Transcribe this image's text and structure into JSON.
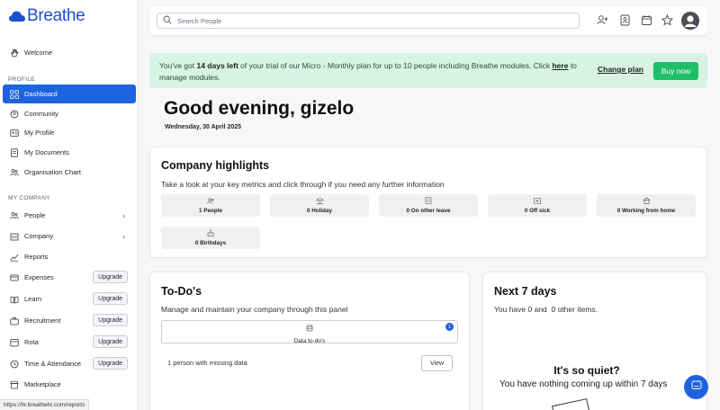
{
  "brand": {
    "name": "Breathe",
    "color": "#1f4fd1"
  },
  "sidebar": {
    "welcome": "Welcome",
    "profile_label": "PROFILE",
    "profile_items": [
      {
        "label": "Dashboard",
        "icon": "dashboard-icon",
        "active": true
      },
      {
        "label": "Community",
        "icon": "community-icon"
      },
      {
        "label": "My Profile",
        "icon": "profile-icon"
      },
      {
        "label": "My Documents",
        "icon": "documents-icon"
      },
      {
        "label": "Organisation Chart",
        "icon": "org-chart-icon"
      }
    ],
    "company_label": "MY COMPANY",
    "company_items": [
      {
        "label": "People",
        "icon": "people-icon"
      },
      {
        "label": "Company",
        "icon": "company-icon"
      },
      {
        "label": "Reports",
        "icon": "reports-icon"
      },
      {
        "label": "Expenses",
        "icon": "expenses-icon",
        "badge": "Upgrade"
      },
      {
        "label": "Learn",
        "icon": "learn-icon",
        "badge": "Upgrade"
      },
      {
        "label": "Recruitment",
        "icon": "recruitment-icon",
        "badge": "Upgrade"
      },
      {
        "label": "Rota",
        "icon": "rota-icon",
        "badge": "Upgrade"
      },
      {
        "label": "Time & Attendance",
        "icon": "time-icon",
        "badge": "Upgrade"
      },
      {
        "label": "Marketplace",
        "icon": "marketplace-icon"
      }
    ]
  },
  "search": {
    "placeholder": "Search People"
  },
  "banner": {
    "text_1": "You've got ",
    "days": "14 days left",
    "text_2": " of your trial of our Micro - Monthly plan for up to 10 people including Breathe modules. Click ",
    "link": "here",
    "text_3": " to manage modules.",
    "change_plan": "Change plan",
    "buy_now": "Buy now",
    "background": "#d8f3e3",
    "button_color": "#1fbf69"
  },
  "greeting": "Good evening, gizelo",
  "date": "Wednesday, 30 April 2025",
  "highlights": {
    "title": "Company highlights",
    "subtitle": "Take a look at your key metrics and click through if you need any further information",
    "metrics": [
      {
        "label": "1 People",
        "icon": "people-icon"
      },
      {
        "label": "0 Holiday",
        "icon": "holiday-icon"
      },
      {
        "label": "0 On other leave",
        "icon": "leave-icon"
      },
      {
        "label": "0 Off sick",
        "icon": "sick-icon"
      },
      {
        "label": "0 Working from home",
        "icon": "home-icon"
      },
      {
        "label": "0 Birthdays",
        "icon": "birthday-icon"
      }
    ]
  },
  "todo": {
    "title": "To-Do's",
    "subtitle": "Manage and maintain your company through this panel",
    "box_label": "Data to-do's",
    "badge": "1",
    "row_text": "1 person with missing data",
    "view": "View"
  },
  "next7": {
    "title": "Next 7 days",
    "subtitle": "You have 0 and  0 other items.",
    "quiet_title": "It's so quiet?",
    "quiet_sub": "You have nothing coming up within 7 days"
  },
  "status_url": "https://hr.breathehr.com/reports",
  "accent": "#1d63e0"
}
